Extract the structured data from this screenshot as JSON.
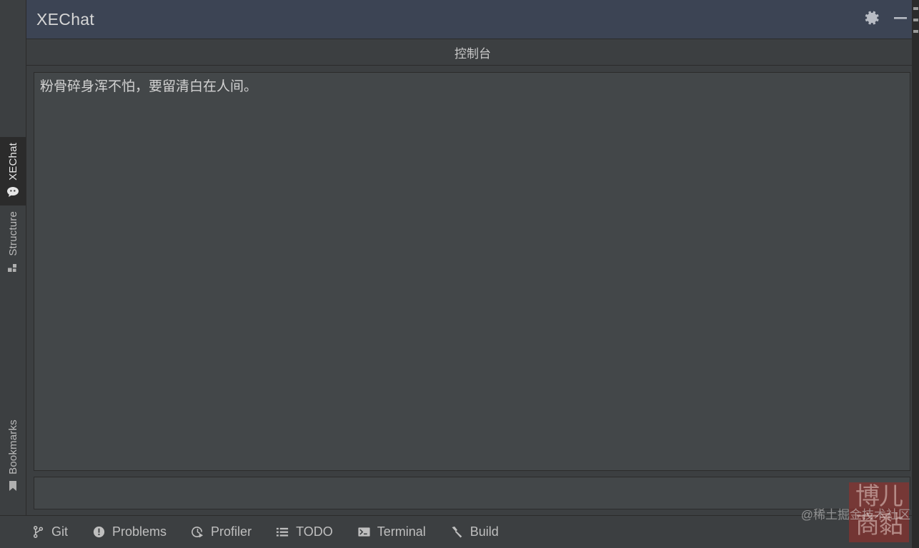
{
  "window": {
    "title": "XEChat",
    "settings_icon": "gear-icon",
    "minimize_icon": "minimize-icon"
  },
  "sidebar": {
    "tabs": [
      {
        "label": "XEChat",
        "icon": "chat-bubble-icon",
        "active": true
      },
      {
        "label": "Structure",
        "icon": "structure-grid-icon",
        "active": false
      },
      {
        "label": "Bookmarks",
        "icon": "bookmark-icon",
        "active": false
      }
    ]
  },
  "console": {
    "header_title": "控制台",
    "output_lines": [
      "粉骨碎身浑不怕，要留清白在人间。"
    ],
    "input_value": "",
    "input_placeholder": ""
  },
  "statusbar": {
    "items": [
      {
        "label": "Git",
        "icon": "git-branch-icon"
      },
      {
        "label": "Problems",
        "icon": "warning-circle-icon"
      },
      {
        "label": "Profiler",
        "icon": "profiler-clock-icon"
      },
      {
        "label": "TODO",
        "icon": "list-icon"
      },
      {
        "label": "Terminal",
        "icon": "terminal-prompt-icon"
      },
      {
        "label": "Build",
        "icon": "hammer-icon"
      }
    ]
  },
  "watermark": {
    "text": "@稀土掘金技术社区",
    "seal_text": "博儿商黏"
  },
  "colors": {
    "titlebar_bg": "#3c4454",
    "panel_bg": "#3c3f41",
    "field_bg": "#434749",
    "active_tab_bg": "#2b2b2b",
    "text": "#bbbbbb",
    "seal_red": "#962e2c"
  }
}
